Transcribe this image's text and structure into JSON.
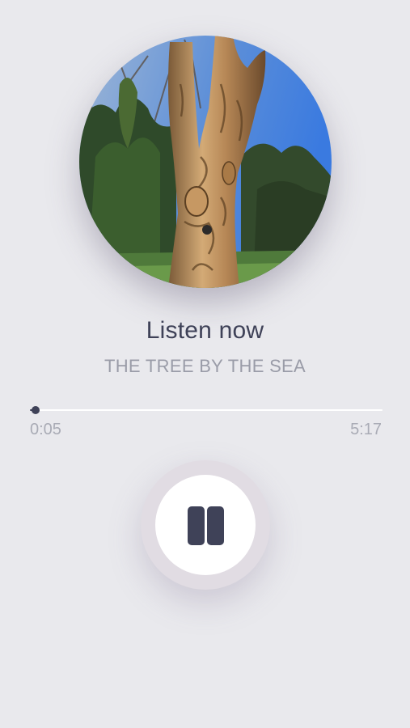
{
  "track": {
    "title": "Listen now",
    "subtitle": "THE TREE BY THE SEA",
    "artwork_icon": "carved-tree-artwork"
  },
  "playback": {
    "elapsed": "0:05",
    "total": "5:17",
    "progress_fraction": 0.016,
    "state": "playing",
    "control_icon": "pause-icon"
  },
  "colors": {
    "background": "#e9e9ed",
    "accent": "#3f4258",
    "muted_text": "#9a9ca8",
    "button_ring": "#e1dce3"
  }
}
